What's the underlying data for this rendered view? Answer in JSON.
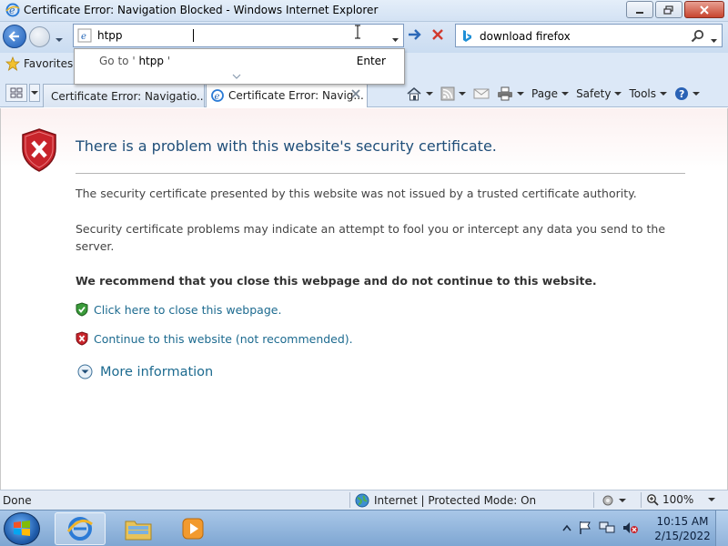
{
  "window": {
    "title": "Certificate Error: Navigation Blocked - Windows Internet Explorer"
  },
  "nav": {
    "address_value": "htpp",
    "search_value": "download firefox",
    "autocomplete": {
      "goto_prefix": "Go to '",
      "goto_term": "htpp",
      "goto_suffix": "'",
      "enter_label": "Enter"
    }
  },
  "favorites": {
    "label": "Favorites"
  },
  "tabs": [
    {
      "label": "Certificate Error: Navigatio..."
    },
    {
      "label": "Certificate Error: Navig..."
    }
  ],
  "toolbar": {
    "page": "Page",
    "safety": "Safety",
    "tools": "Tools"
  },
  "content": {
    "headline": "There is a problem with this website's security certificate.",
    "p1": "The security certificate presented by this website was not issued by a trusted certificate authority.",
    "p2": "Security certificate problems may indicate an attempt to fool you or intercept any data you send to the server.",
    "recommend": "We recommend that you close this webpage and do not continue to this website.",
    "close_link": "Click here to close this webpage.",
    "continue_link": "Continue to this website (not recommended).",
    "more_info": "More information"
  },
  "status": {
    "done": "Done",
    "zone": "Internet | Protected Mode: On",
    "zoom": "100%"
  },
  "taskbar": {
    "time": "10:15 AM",
    "date": "2/15/2022"
  },
  "colors": {
    "link": "#1c6a8f",
    "headline": "#1f4e79",
    "shield_red": "#c8242b",
    "shield_green": "#3a9b3a"
  },
  "icons": {
    "title_icon": "ie-icon",
    "back": "back-arrow-icon",
    "forward": "forward-arrow-icon",
    "go": "go-arrow-icon",
    "stop": "stop-icon",
    "search": "search-icon",
    "favorites": "star-icon",
    "home": "home-icon",
    "feeds": "rss-icon",
    "mail": "mail-icon",
    "print": "printer-icon",
    "help": "help-icon",
    "error_shield": "shield-x-icon",
    "globe": "globe-icon"
  }
}
